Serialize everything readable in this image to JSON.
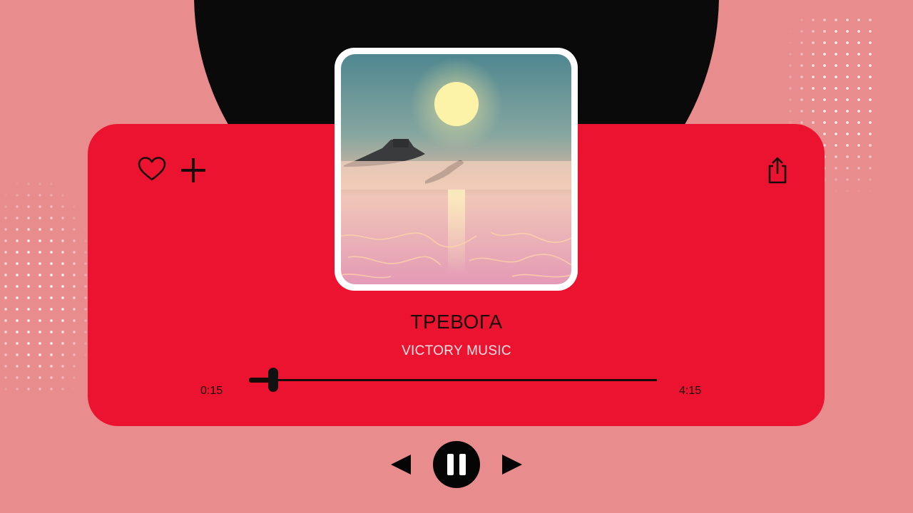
{
  "track": {
    "title": "ТРЕВОГА",
    "artist": "VICTORY MUSIC"
  },
  "playback": {
    "current_time": "0:15",
    "total_time": "4:15",
    "progress_fraction": 0.06,
    "state": "playing"
  },
  "actions": {
    "like_icon": "heart-outline-icon",
    "add_icon": "plus-icon",
    "share_icon": "share-icon"
  },
  "controls": {
    "prev_icon": "previous-triangle-icon",
    "pause_icon": "pause-icon",
    "next_icon": "next-triangle-icon"
  },
  "colors": {
    "background": "#e88c8e",
    "card": "#ec1330",
    "disc": "#0a0a0a",
    "text_dark": "#1a0b0b",
    "text_light": "#fde3e4"
  }
}
